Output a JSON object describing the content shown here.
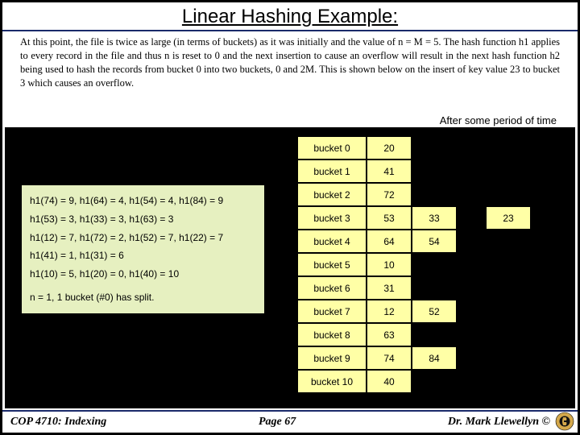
{
  "title": "Linear Hashing Example:",
  "body_text": "At this point, the file is twice as large (in terms of buckets) as it was initially and the value of n = M = 5.  The hash function h1 applies to every record in the file and thus n is reset to 0 and the next insertion to cause an overflow will result in the next hash function h2 being used to hash the records from bucket 0 into two buckets, 0 and 2M.  This is shown below on the insert of key value 23 to bucket 3 which causes an overflow.",
  "after_text": "After some period of time",
  "hash_lines": {
    "l0": "h1(74) = 9, h1(64) = 4, h1(54) = 4, h1(84) = 9",
    "l1": "h1(53) = 3, h1(33) = 3, h1(63) = 3",
    "l2": "h1(12) = 7, h1(72) = 2, h1(52) = 7, h1(22) = 7",
    "l3": "h1(41) = 1, h1(31) = 6",
    "l4": "h1(10) = 5, h1(20) = 0, h1(40) = 10",
    "l5": "n = 1, 1 bucket (#0) has split."
  },
  "buckets": [
    {
      "label": "bucket 0",
      "v0": "20",
      "v1": "",
      "ov": ""
    },
    {
      "label": "bucket 1",
      "v0": "41",
      "v1": "",
      "ov": ""
    },
    {
      "label": "bucket 2",
      "v0": "72",
      "v1": "",
      "ov": ""
    },
    {
      "label": "bucket 3",
      "v0": "53",
      "v1": "33",
      "ov": "23"
    },
    {
      "label": "bucket 4",
      "v0": "64",
      "v1": "54",
      "ov": ""
    },
    {
      "label": "bucket 5",
      "v0": "10",
      "v1": "",
      "ov": ""
    },
    {
      "label": "bucket 6",
      "v0": "31",
      "v1": "",
      "ov": ""
    },
    {
      "label": "bucket 7",
      "v0": "12",
      "v1": "52",
      "ov": ""
    },
    {
      "label": "bucket 8",
      "v0": "63",
      "v1": "",
      "ov": ""
    },
    {
      "label": "bucket 9",
      "v0": "74",
      "v1": "84",
      "ov": ""
    },
    {
      "label": "bucket 10",
      "v0": "40",
      "v1": "",
      "ov": ""
    }
  ],
  "footer": {
    "left": "COP 4710: Indexing",
    "mid": "Page 67",
    "right": "Dr. Mark Llewellyn ©"
  }
}
